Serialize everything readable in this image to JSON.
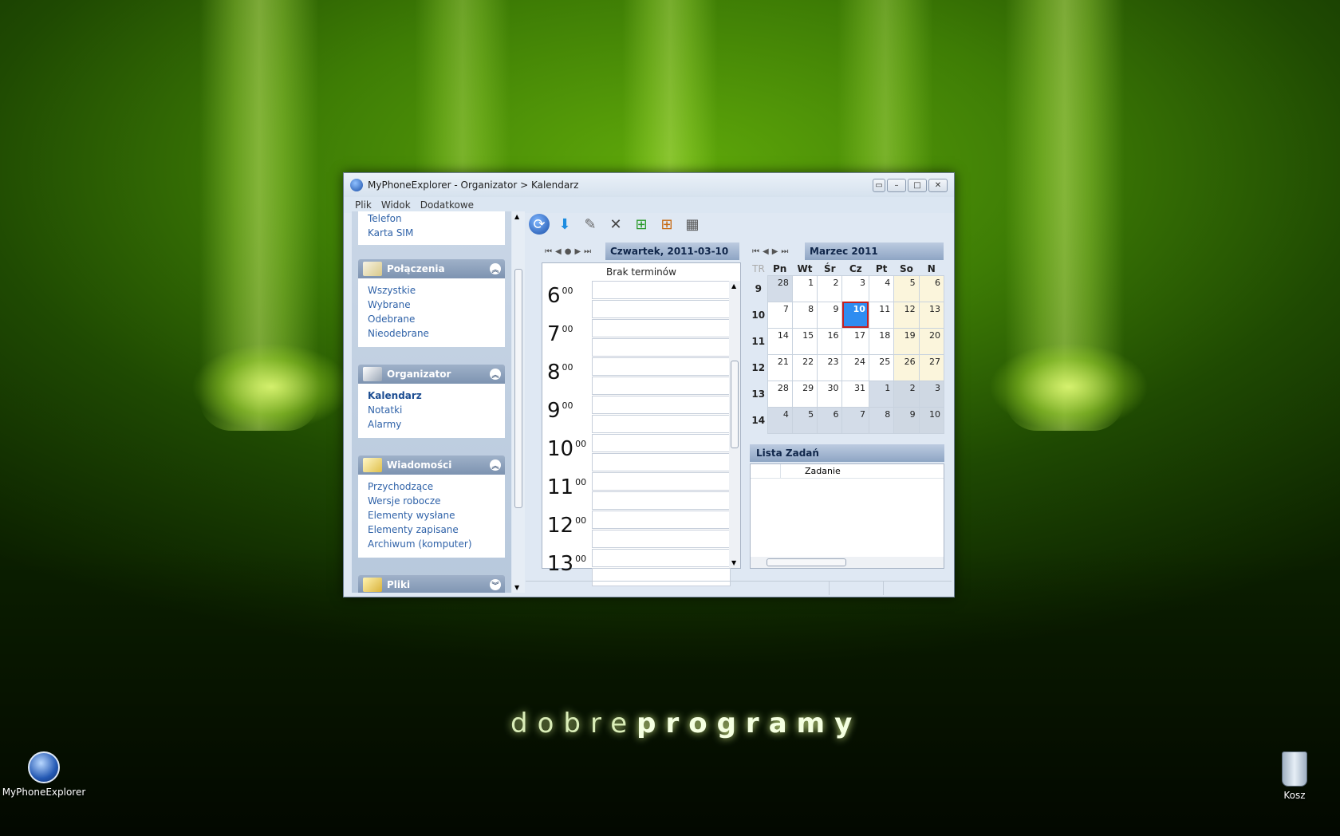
{
  "desktop": {
    "brand_thin": "dobre",
    "brand_bold": "programy",
    "icons": [
      {
        "label": "MyPhoneExplorer"
      },
      {
        "label": "Kosz"
      }
    ]
  },
  "window": {
    "title": "MyPhoneExplorer -  Organizator > Kalendarz",
    "menu": [
      "Plik",
      "Widok",
      "Dodatkowe"
    ]
  },
  "sidebar": {
    "top_links": [
      "Telefon",
      "Karta SIM"
    ],
    "groups": [
      {
        "title": "Połączenia",
        "items": [
          "Wszystkie",
          "Wybrane",
          "Odebrane",
          "Nieodebrane"
        ]
      },
      {
        "title": "Organizator",
        "items": [
          "Kalendarz",
          "Notatki",
          "Alarmy"
        ]
      },
      {
        "title": "Wiadomości",
        "items": [
          "Przychodzące",
          "Wersje robocze",
          "Elementy wysłane",
          "Elementy zapisane",
          "Archiwum (komputer)"
        ]
      },
      {
        "title": "Pliki",
        "items": []
      }
    ]
  },
  "day": {
    "header": "Czwartek, 2011-03-10",
    "caption": "Brak terminów",
    "hours": [
      "6",
      "7",
      "8",
      "9",
      "10",
      "11",
      "12",
      "13"
    ],
    "minutes": "00"
  },
  "month": {
    "header": "Marzec 2011",
    "week_col": "TR",
    "weekdays": [
      "Pn",
      "Wt",
      "Śr",
      "Cz",
      "Pt",
      "So",
      "N"
    ],
    "weeks": [
      {
        "num": "9",
        "days": [
          "28",
          "1",
          "2",
          "3",
          "4",
          "5",
          "6"
        ]
      },
      {
        "num": "10",
        "days": [
          "7",
          "8",
          "9",
          "10",
          "11",
          "12",
          "13"
        ]
      },
      {
        "num": "11",
        "days": [
          "14",
          "15",
          "16",
          "17",
          "18",
          "19",
          "20"
        ]
      },
      {
        "num": "12",
        "days": [
          "21",
          "22",
          "23",
          "24",
          "25",
          "26",
          "27"
        ]
      },
      {
        "num": "13",
        "days": [
          "28",
          "29",
          "30",
          "31",
          "1",
          "2",
          "3"
        ]
      },
      {
        "num": "14",
        "days": [
          "4",
          "5",
          "6",
          "7",
          "8",
          "9",
          "10"
        ]
      }
    ],
    "today": "10"
  },
  "tasks": {
    "header": "Lista Zadań",
    "column": "Zadanie"
  }
}
